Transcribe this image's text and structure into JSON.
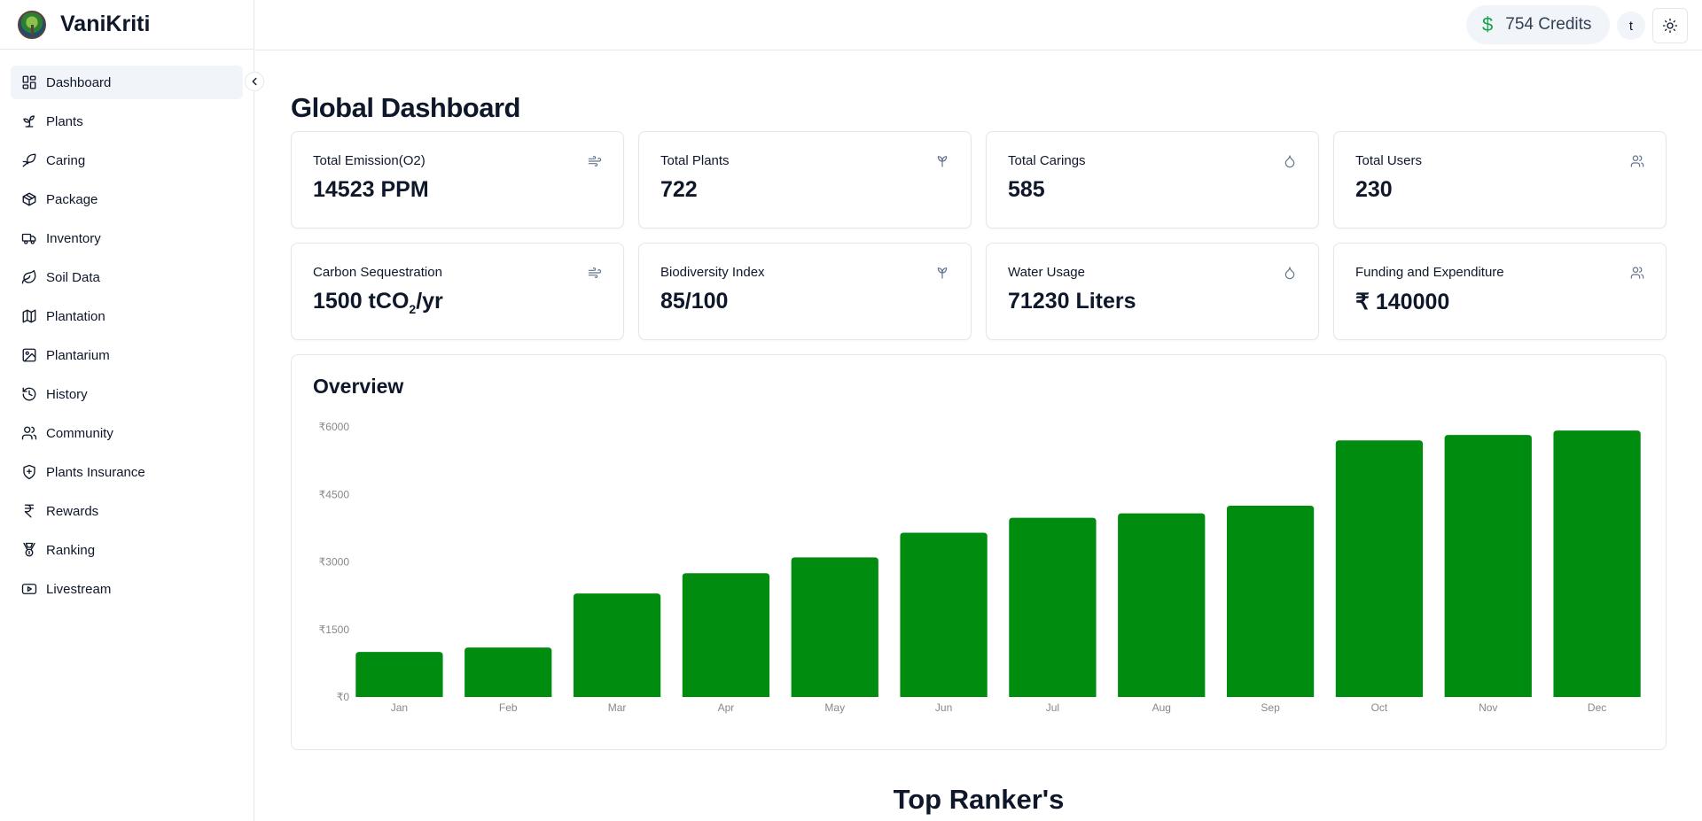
{
  "app": {
    "name": "VaniKriti"
  },
  "header": {
    "credits_symbol": "$",
    "credits_label": "754 Credits",
    "avatar_initial": "t"
  },
  "sidebar": {
    "items": [
      {
        "label": "Dashboard",
        "icon": "dashboard-icon"
      },
      {
        "label": "Plants",
        "icon": "sprout-icon"
      },
      {
        "label": "Caring",
        "icon": "leaf-hand-icon"
      },
      {
        "label": "Package",
        "icon": "package-icon"
      },
      {
        "label": "Inventory",
        "icon": "truck-icon"
      },
      {
        "label": "Soil Data",
        "icon": "leaf-icon"
      },
      {
        "label": "Plantation",
        "icon": "map-icon"
      },
      {
        "label": "Plantarium",
        "icon": "image-icon"
      },
      {
        "label": "History",
        "icon": "history-icon"
      },
      {
        "label": "Community",
        "icon": "users-icon"
      },
      {
        "label": "Plants Insurance",
        "icon": "shield-icon"
      },
      {
        "label": "Rewards",
        "icon": "rupee-icon"
      },
      {
        "label": "Ranking",
        "icon": "medal-icon"
      },
      {
        "label": "Livestream",
        "icon": "youtube-icon"
      }
    ]
  },
  "main": {
    "title": "Global Dashboard",
    "cards": [
      {
        "title": "Total Emission(O2)",
        "value": "14523 PPM",
        "icon": "wind-icon"
      },
      {
        "title": "Total Plants",
        "value": "722",
        "icon": "sprout-icon"
      },
      {
        "title": "Total Carings",
        "value": "585",
        "icon": "droplet-icon"
      },
      {
        "title": "Total Users",
        "value": "230",
        "icon": "users-icon"
      },
      {
        "title": "Carbon Sequestration",
        "value_prefix": "1500 tCO",
        "value_sub": "2",
        "value_suffix": "/yr",
        "icon": "wind-icon"
      },
      {
        "title": "Biodiversity Index",
        "value": "85/100",
        "icon": "sprout-icon"
      },
      {
        "title": "Water Usage",
        "value": "71230 Liters",
        "icon": "droplet-icon"
      },
      {
        "title": "Funding and Expenditure",
        "value": "₹ 140000",
        "icon": "users-icon"
      }
    ],
    "overview_title": "Overview",
    "top_rankers_title": "Top Ranker's"
  },
  "colors": {
    "bar": "#008c0e",
    "accent_green": "#16a34a"
  },
  "chart_data": {
    "type": "bar",
    "categories": [
      "Jan",
      "Feb",
      "Mar",
      "Apr",
      "May",
      "Jun",
      "Jul",
      "Aug",
      "Sep",
      "Oct",
      "Nov",
      "Dec"
    ],
    "values": [
      1000,
      1100,
      2300,
      2750,
      3100,
      3650,
      3980,
      4080,
      4250,
      5700,
      5820,
      5920
    ],
    "yticks": [
      "₹0",
      "₹1500",
      "₹3000",
      "₹4500",
      "₹6000"
    ],
    "ytick_values": [
      0,
      1500,
      3000,
      4500,
      6000
    ],
    "ylim": [
      0,
      6000
    ],
    "title": "Overview",
    "xlabel": "",
    "ylabel": "",
    "grid": false,
    "legend": "none"
  }
}
